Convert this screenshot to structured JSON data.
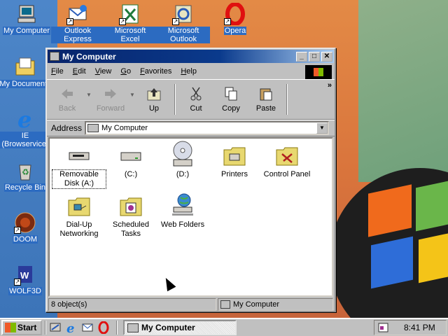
{
  "desktop": {
    "icons": [
      {
        "label": "My Computer",
        "icon": "my-computer-icon"
      },
      {
        "label": "Outlook Express",
        "icon": "outlook-express-icon"
      },
      {
        "label": "Microsoft Excel",
        "icon": "excel-icon"
      },
      {
        "label": "Microsoft Outlook",
        "icon": "outlook-icon"
      },
      {
        "label": "Opera",
        "icon": "opera-icon"
      },
      {
        "label": "My Documents",
        "icon": "my-documents-icon"
      },
      {
        "label": "IE (Browservice)",
        "icon": "internet-explorer-icon"
      },
      {
        "label": "Recycle Bin",
        "icon": "recycle-bin-icon"
      },
      {
        "label": "DOOM",
        "icon": "doom-icon"
      },
      {
        "label": "WOLF3D",
        "icon": "wolf3d-icon"
      }
    ]
  },
  "window": {
    "title": "My Computer",
    "controls": {
      "minimize": "_",
      "maximize": "□",
      "close": "✕"
    },
    "menu": [
      "File",
      "Edit",
      "View",
      "Go",
      "Favorites",
      "Help"
    ],
    "toolbar": {
      "back": "Back",
      "forward": "Forward",
      "up": "Up",
      "cut": "Cut",
      "copy": "Copy",
      "paste": "Paste",
      "more": "»"
    },
    "address": {
      "label": "Address",
      "value": "My Computer"
    },
    "items": [
      {
        "label": "Removable Disk (A:)",
        "icon": "floppy-drive-icon"
      },
      {
        "label": "(C:)",
        "icon": "hard-drive-icon"
      },
      {
        "label": "(D:)",
        "icon": "cd-drive-icon"
      },
      {
        "label": "Printers",
        "icon": "printers-folder-icon"
      },
      {
        "label": "Control Panel",
        "icon": "control-panel-folder-icon"
      },
      {
        "label": "Dial-Up Networking",
        "icon": "dialup-folder-icon"
      },
      {
        "label": "Scheduled Tasks",
        "icon": "scheduled-tasks-folder-icon"
      },
      {
        "label": "Web Folders",
        "icon": "web-folders-icon"
      }
    ],
    "status": {
      "count": "8 object(s)",
      "location": "My Computer"
    }
  },
  "taskbar": {
    "start": "Start",
    "quick_launch": [
      "show-desktop-icon",
      "internet-explorer-icon",
      "outlook-express-icon",
      "opera-icon"
    ],
    "task": "My Computer",
    "clock": "8:41 PM"
  },
  "colors": {
    "titlebar": "#08246b",
    "desktop_blue": "#3c74b8",
    "selection_label": "#2c6bc1"
  }
}
